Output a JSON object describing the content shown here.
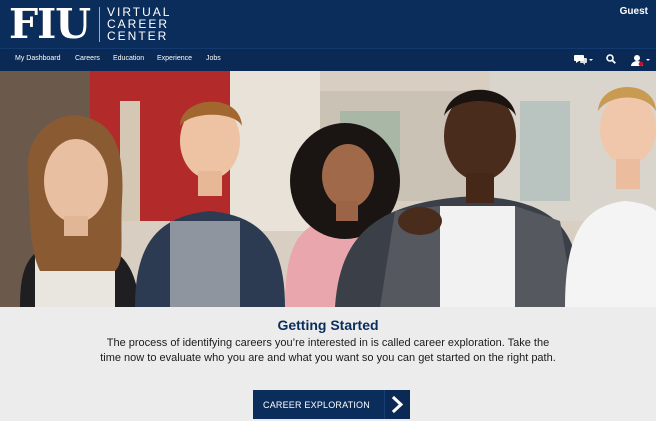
{
  "header": {
    "logo_main": "FIU",
    "logo_lines": [
      "VIRTUAL",
      "CAREER",
      "CENTER"
    ],
    "user_label": "Guest"
  },
  "nav": {
    "items": [
      {
        "label": "My Dashboard"
      },
      {
        "label": "Careers"
      },
      {
        "label": "Education"
      },
      {
        "label": "Experience"
      },
      {
        "label": "Jobs"
      }
    ],
    "icons": [
      "chat-icon",
      "search-icon",
      "user-icon"
    ]
  },
  "hero": {
    "description": "students-photo"
  },
  "main": {
    "title": "Getting Started",
    "body": "The process of identifying careers you’re interested in is called career exploration. Take the time now to evaluate who you are and what you want so you can get started on the right path.",
    "cta_label": "CAREER EXPLORATION"
  },
  "colors": {
    "header_bg": "#0b2d5b",
    "nav_bg": "#0a2a55",
    "section_bg": "#ececec",
    "title": "#0b2d5b",
    "gold": "#c9a94f"
  }
}
